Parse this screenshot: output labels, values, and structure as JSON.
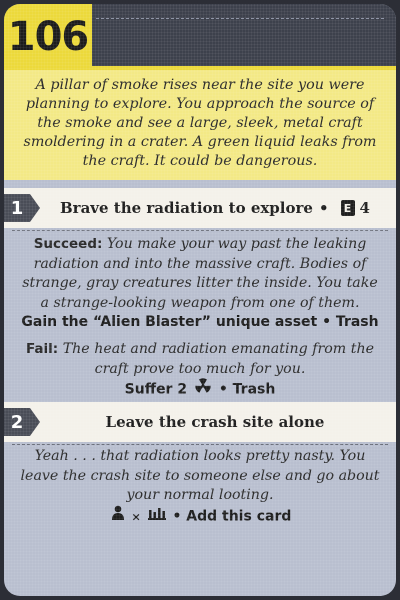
{
  "card": {
    "number": "106",
    "intro": "A pillar of smoke rises near the site you were planning to explore. You approach the source of the smoke and see a large, sleek, metal craft smoldering in a crater. A green liquid leaks from the craft. It could be dangerous."
  },
  "option1": {
    "badge": "1",
    "label": "Brave the radiation to explore",
    "separator": "•",
    "test_icon_letter": "E",
    "test_value": "4",
    "succeed": {
      "keyword": "Succeed:",
      "text": "You make your way past the leaking radiation and into the massive craft. Bodies of strange, gray creatures litter the inside. You take a strange-looking weapon from one of them.",
      "result": "Gain the “Alien Blaster” unique asset • Trash"
    },
    "fail": {
      "keyword": "Fail:",
      "text": "The heat and radiation emanating from the craft prove too much for you.",
      "result_prefix": "Suffer 2",
      "result_suffix": "• Trash"
    }
  },
  "option2": {
    "badge": "2",
    "label": "Leave the crash site alone",
    "text": "Yeah . . . that radiation looks pretty nasty. You leave the crash site to someone else and go about your normal looting.",
    "times": "×",
    "result_suffix": "• Add this card"
  },
  "icons": [
    "radiation-icon",
    "player-icon",
    "settlement-icon",
    "e-stat-icon"
  ]
}
